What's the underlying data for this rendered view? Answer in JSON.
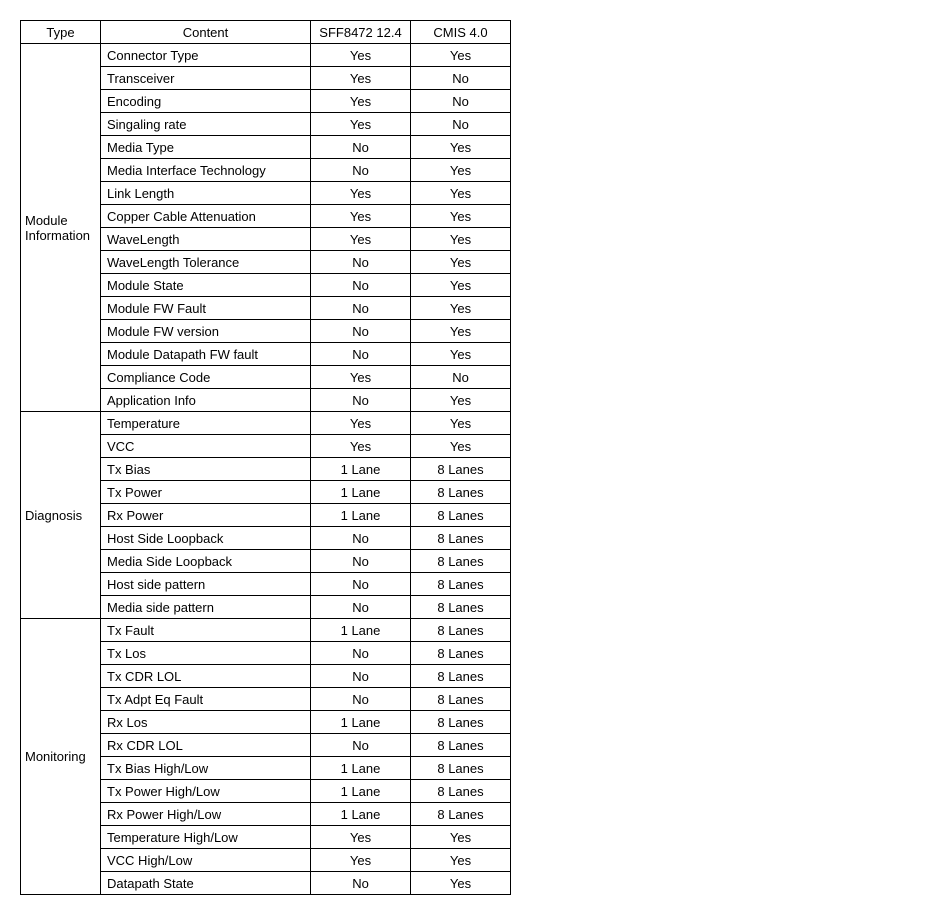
{
  "headers": {
    "type": "Type",
    "content": "Content",
    "sff": "SFF8472 12.4",
    "cmis": "CMIS 4.0"
  },
  "sections": [
    {
      "type_label": "Module Information",
      "rows": [
        {
          "content": "Connector Type",
          "sff": "Yes",
          "cmis": "Yes"
        },
        {
          "content": "Transceiver",
          "sff": "Yes",
          "cmis": "No"
        },
        {
          "content": "Encoding",
          "sff": "Yes",
          "cmis": "No"
        },
        {
          "content": "Singaling rate",
          "sff": "Yes",
          "cmis": "No"
        },
        {
          "content": "Media Type",
          "sff": "No",
          "cmis": "Yes"
        },
        {
          "content": "Media Interface Technology",
          "sff": "No",
          "cmis": "Yes"
        },
        {
          "content": "Link Length",
          "sff": "Yes",
          "cmis": "Yes"
        },
        {
          "content": "Copper Cable Attenuation",
          "sff": "Yes",
          "cmis": "Yes"
        },
        {
          "content": "WaveLength",
          "sff": "Yes",
          "cmis": "Yes"
        },
        {
          "content": "WaveLength Tolerance",
          "sff": "No",
          "cmis": "Yes"
        },
        {
          "content": "Module State",
          "sff": "No",
          "cmis": "Yes"
        },
        {
          "content": "Module FW Fault",
          "sff": "No",
          "cmis": "Yes"
        },
        {
          "content": "Module FW version",
          "sff": "No",
          "cmis": "Yes"
        },
        {
          "content": "Module Datapath FW fault",
          "sff": "No",
          "cmis": "Yes"
        },
        {
          "content": "Compliance Code",
          "sff": "Yes",
          "cmis": "No"
        },
        {
          "content": "Application Info",
          "sff": "No",
          "cmis": "Yes"
        }
      ]
    },
    {
      "type_label": "Diagnosis",
      "rows": [
        {
          "content": "Temperature",
          "sff": "Yes",
          "cmis": "Yes"
        },
        {
          "content": "VCC",
          "sff": "Yes",
          "cmis": "Yes"
        },
        {
          "content": "Tx Bias",
          "sff": "1 Lane",
          "cmis": "8 Lanes"
        },
        {
          "content": "Tx Power",
          "sff": "1 Lane",
          "cmis": "8 Lanes"
        },
        {
          "content": "Rx Power",
          "sff": "1 Lane",
          "cmis": "8 Lanes"
        },
        {
          "content": "Host Side Loopback",
          "sff": "No",
          "cmis": "8 Lanes"
        },
        {
          "content": "Media Side Loopback",
          "sff": "No",
          "cmis": "8 Lanes"
        },
        {
          "content": "Host side pattern",
          "sff": "No",
          "cmis": "8 Lanes"
        },
        {
          "content": "Media side pattern",
          "sff": "No",
          "cmis": "8 Lanes"
        }
      ]
    },
    {
      "type_label": "Monitoring",
      "rows": [
        {
          "content": "Tx Fault",
          "sff": "1 Lane",
          "cmis": "8 Lanes"
        },
        {
          "content": "Tx Los",
          "sff": "No",
          "cmis": "8 Lanes"
        },
        {
          "content": "Tx CDR LOL",
          "sff": "No",
          "cmis": "8 Lanes"
        },
        {
          "content": "Tx Adpt Eq Fault",
          "sff": "No",
          "cmis": "8 Lanes"
        },
        {
          "content": "Rx Los",
          "sff": "1 Lane",
          "cmis": "8 Lanes"
        },
        {
          "content": "Rx CDR LOL",
          "sff": "No",
          "cmis": "8 Lanes"
        },
        {
          "content": "Tx Bias High/Low",
          "sff": "1 Lane",
          "cmis": "8 Lanes"
        },
        {
          "content": "Tx Power High/Low",
          "sff": "1 Lane",
          "cmis": "8 Lanes"
        },
        {
          "content": "Rx Power High/Low",
          "sff": "1 Lane",
          "cmis": "8 Lanes"
        },
        {
          "content": "Temperature High/Low",
          "sff": "Yes",
          "cmis": "Yes"
        },
        {
          "content": "VCC High/Low",
          "sff": "Yes",
          "cmis": "Yes"
        },
        {
          "content": "Datapath State",
          "sff": "No",
          "cmis": "Yes"
        }
      ]
    }
  ]
}
